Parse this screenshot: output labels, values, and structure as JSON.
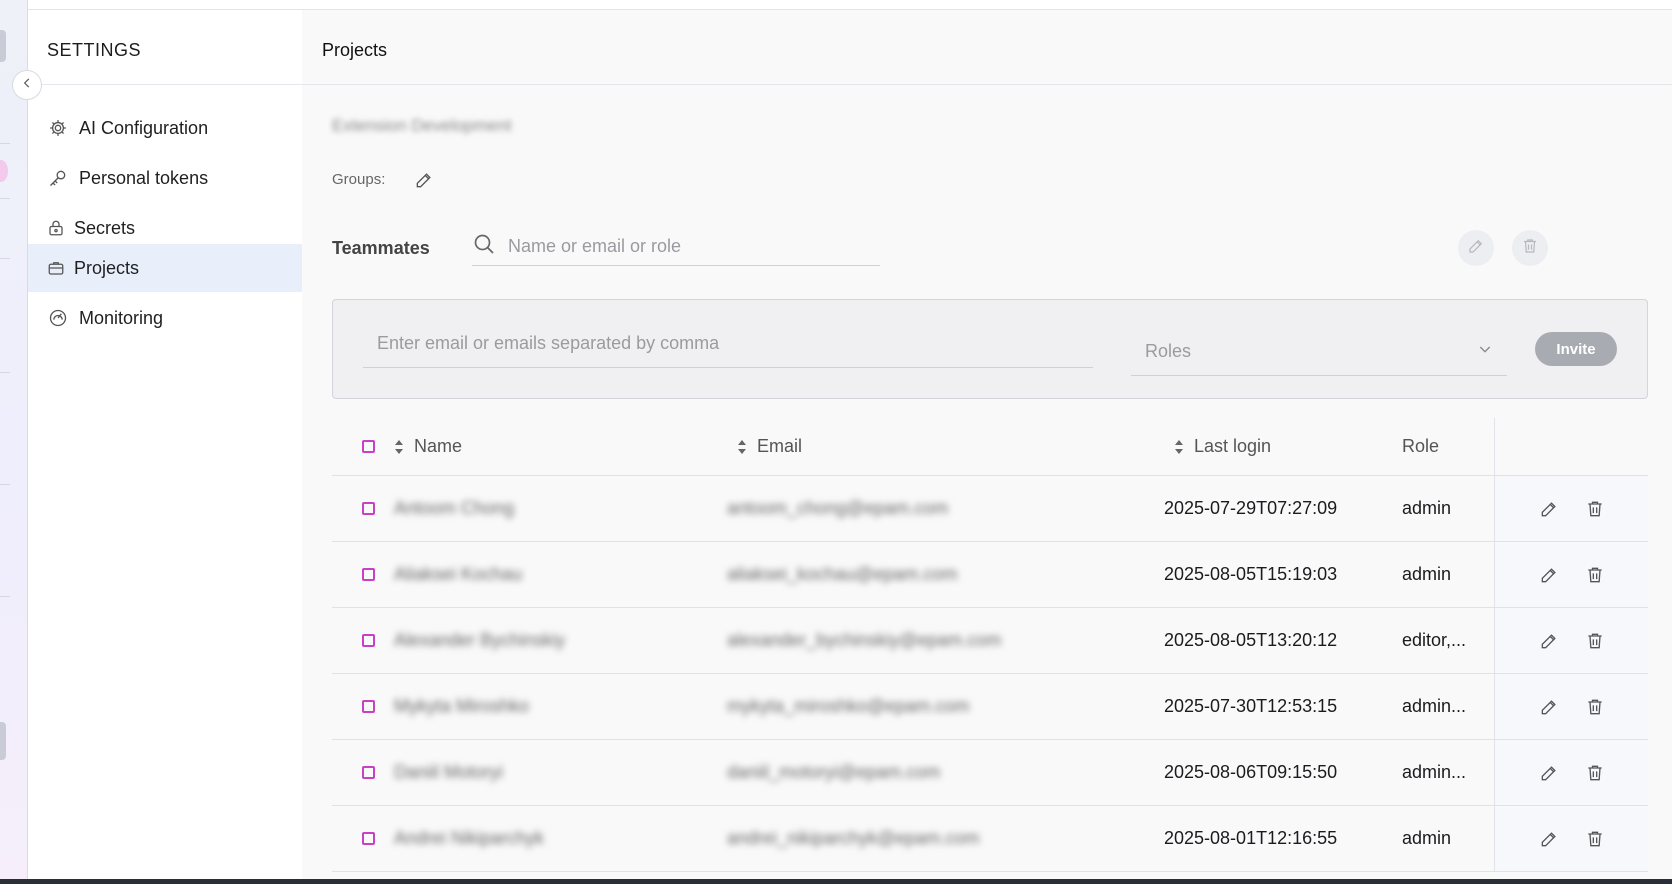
{
  "sidebar": {
    "title": "SETTINGS",
    "items": [
      {
        "label": "AI Configuration",
        "icon": "gear-icon"
      },
      {
        "label": "Personal tokens",
        "icon": "key-icon"
      },
      {
        "label": "Secrets",
        "icon": "lock-icon"
      },
      {
        "label": "Projects",
        "icon": "briefcase-icon",
        "active": true
      },
      {
        "label": "Monitoring",
        "icon": "dashboard-icon"
      }
    ]
  },
  "main": {
    "title": "Projects",
    "project_name": "Extension Development",
    "groups_label": "Groups:",
    "teammates_label": "Teammates",
    "search_placeholder": "Name or email or role"
  },
  "invite": {
    "email_placeholder": "Enter email or emails separated by comma",
    "roles_placeholder": "Roles",
    "invite_label": "Invite"
  },
  "table": {
    "columns": {
      "name": "Name",
      "email": "Email",
      "last_login": "Last login",
      "role": "Role"
    },
    "rows": [
      {
        "name": "Antoom Chong",
        "email": "antoom_chong@epam.com",
        "last_login": "2025-07-29T07:27:09",
        "role": "admin"
      },
      {
        "name": "Aliaksei Kochau",
        "email": "aliaksei_kochau@epam.com",
        "last_login": "2025-08-05T15:19:03",
        "role": "admin"
      },
      {
        "name": "Alexander Bychinskiy",
        "email": "alexander_bychinskiy@epam.com",
        "last_login": "2025-08-05T13:20:12",
        "role": "editor,..."
      },
      {
        "name": "Mykyta Miroshko",
        "email": "mykyta_miroshko@epam.com",
        "last_login": "2025-07-30T12:53:15",
        "role": "admin..."
      },
      {
        "name": "Daniil Motoryi",
        "email": "daniil_motoryi@epam.com",
        "last_login": "2025-08-06T09:15:50",
        "role": "admin..."
      },
      {
        "name": "Andrei Nikiparchyk",
        "email": "andrei_nikiparchyk@epam.com",
        "last_login": "2025-08-01T12:16:55",
        "role": "admin"
      }
    ]
  },
  "colors": {
    "accent_checkbox": "#c940c4",
    "active_nav_bg": "#e9eefb"
  }
}
